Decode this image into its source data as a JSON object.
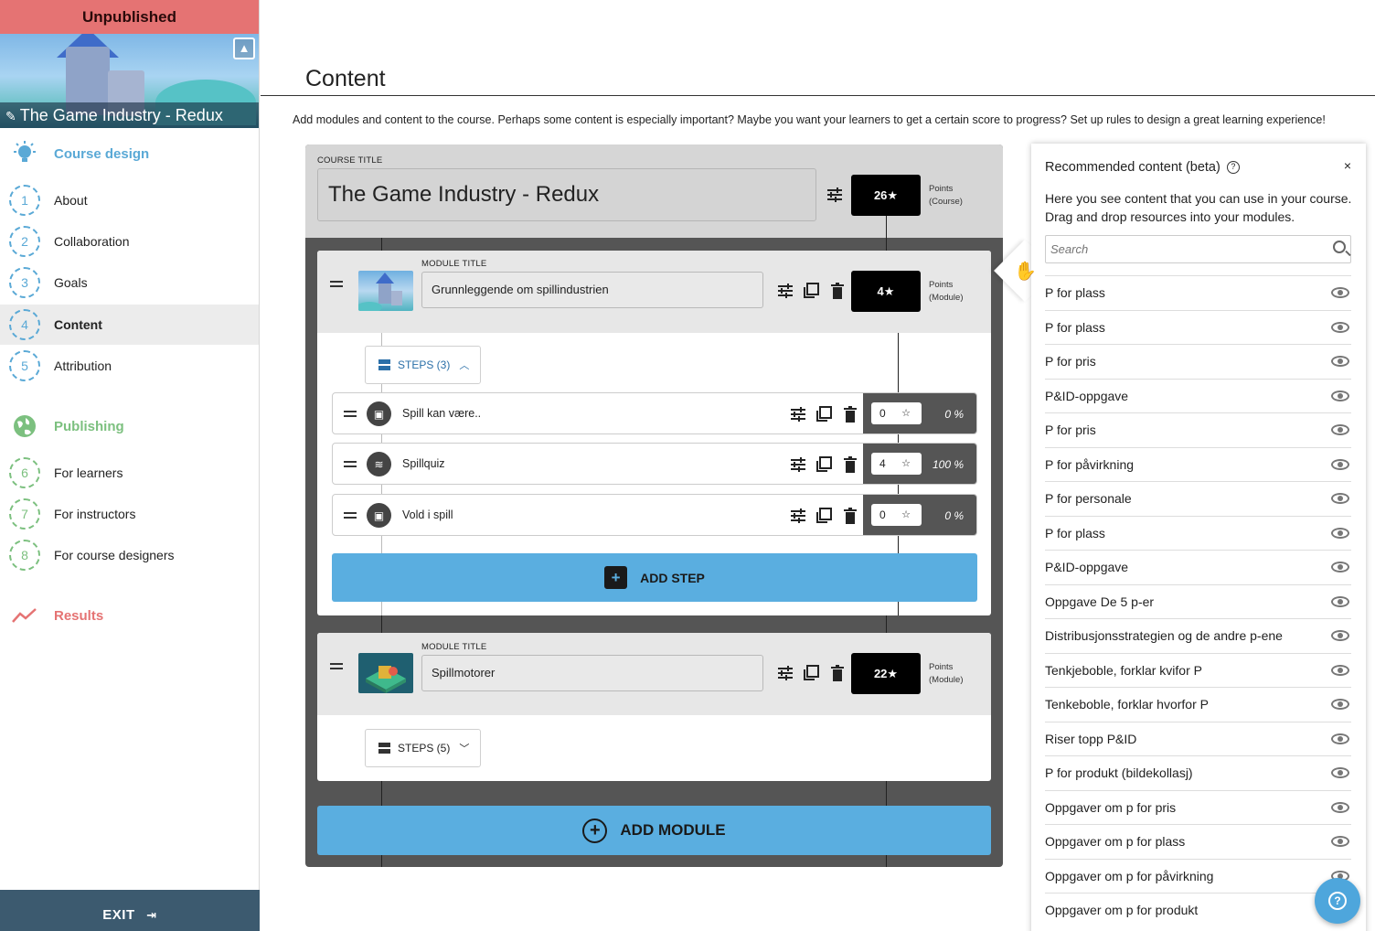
{
  "sidebar": {
    "status": "Unpublished",
    "course_title": "The Game Industry - Redux",
    "sections": {
      "design": "Course design",
      "publishing": "Publishing",
      "results": "Results"
    },
    "design_items": [
      {
        "num": "1",
        "label": "About"
      },
      {
        "num": "2",
        "label": "Collaboration"
      },
      {
        "num": "3",
        "label": "Goals"
      },
      {
        "num": "4",
        "label": "Content"
      },
      {
        "num": "5",
        "label": "Attribution"
      }
    ],
    "publishing_items": [
      {
        "num": "6",
        "label": "For learners"
      },
      {
        "num": "7",
        "label": "For instructors"
      },
      {
        "num": "8",
        "label": "For course designers"
      }
    ],
    "exit_label": "EXIT",
    "colors": {
      "status_bg": "#e57373",
      "design": "#5aa9d6",
      "publishing": "#7cc07f",
      "results": "#e57373",
      "exit_bg": "#3c5a6f"
    }
  },
  "main": {
    "title": "Content",
    "intro": "Add modules and content to the course. Perhaps some content is especially important? Maybe you want your learners to get a certain score to progress? Set up rules to design a great learning experience!"
  },
  "course": {
    "title_label": "COURSE TITLE",
    "title": "The Game Industry - Redux",
    "points": "26★",
    "points_label_1": "Points",
    "points_label_2": "(Course)"
  },
  "modules": [
    {
      "title_label": "MODULE TITLE",
      "title": "Grunnleggende om spillindustrien",
      "points": "4★",
      "points_label_1": "Points",
      "points_label_2": "(Module)",
      "steps_label": "STEPS (3)",
      "steps": [
        {
          "title": "Spill kan være..",
          "points": "0",
          "percent": "0 %"
        },
        {
          "title": "Spillquiz",
          "points": "4",
          "percent": "100 %"
        },
        {
          "title": "Vold i spill",
          "points": "0",
          "percent": "0 %"
        }
      ],
      "add_step_label": "ADD STEP"
    },
    {
      "title_label": "MODULE TITLE",
      "title": "Spillmotorer",
      "points": "22★",
      "points_label_1": "Points",
      "points_label_2": "(Module)",
      "steps_label": "STEPS (5)"
    }
  ],
  "add_module_label": "ADD MODULE",
  "recommended": {
    "title": "Recommended content (beta)",
    "close": "×",
    "description": "Here you see content that you can use in your course. Drag and drop resources into your modules.",
    "search_placeholder": "Search",
    "items": [
      "P for plass",
      "P for plass",
      "P for pris",
      "P&ID-oppgave",
      "P for pris",
      "P for påvirkning",
      "P for personale",
      "P for plass",
      "P&ID-oppgave",
      "Oppgave De 5 p-er",
      "Distribusjonsstrategien og de andre p-ene",
      "Tenkjeboble, forklar kvifor P",
      "Tenkeboble, forklar hvorfor P",
      "Riser topp P&ID",
      "P for produkt (bildekollasj)",
      "Oppgaver om p for pris",
      "Oppgaver om p for plass",
      "Oppgaver om p for påvirkning",
      "Oppgaver om p for produkt"
    ]
  },
  "help_label": "?"
}
